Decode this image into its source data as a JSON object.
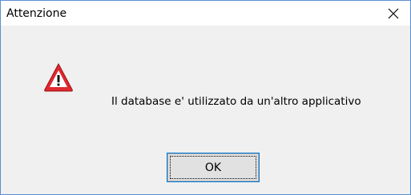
{
  "window": {
    "title": "Attenzione",
    "close_icon": "close-icon",
    "border_color": "#5a8fd0"
  },
  "message": {
    "icon": "warning-icon",
    "text": "Il database e' utilizzato da un'altro applicativo"
  },
  "buttons": {
    "ok_label": "OK"
  },
  "colors": {
    "warning_red": "#e0282e",
    "button_focus": "#0078d7",
    "dialog_bg": "#f0f0f0"
  }
}
